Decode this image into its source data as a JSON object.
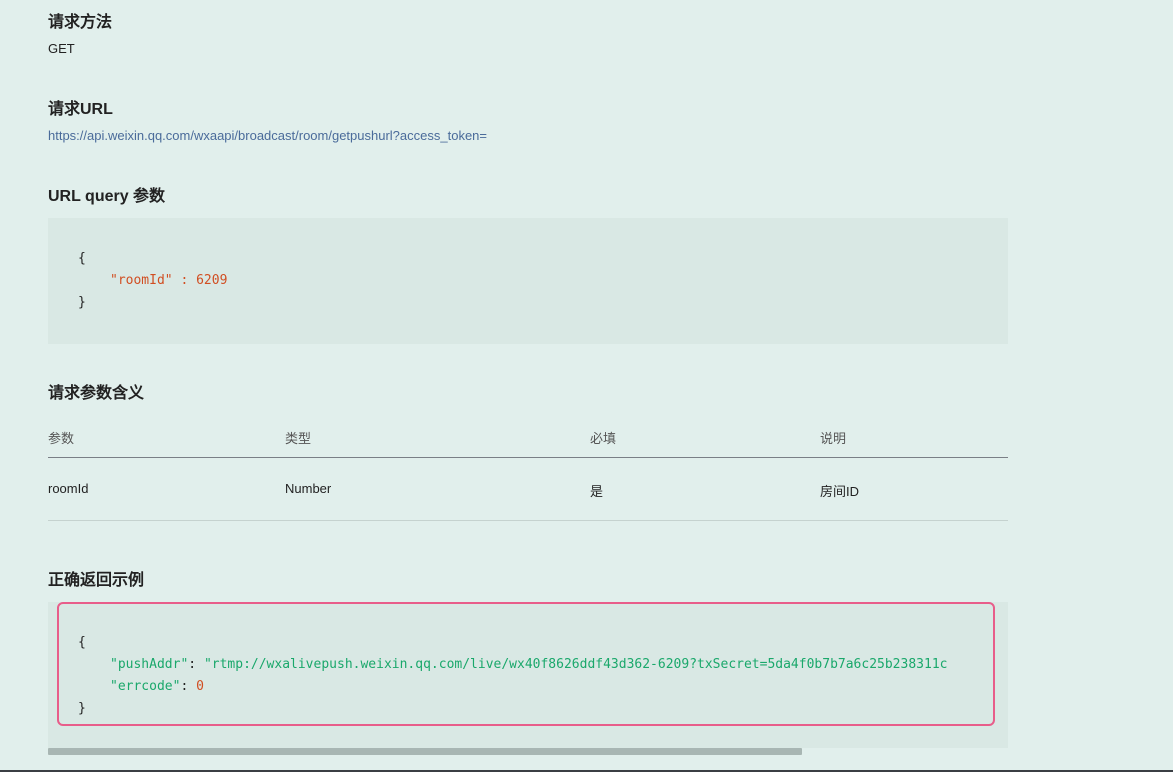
{
  "sections": {
    "method": {
      "title": "请求方法",
      "value": "GET"
    },
    "url": {
      "title": "请求URL",
      "value": "https://api.weixin.qq.com/wxaapi/broadcast/room/getpushurl?access_token="
    },
    "query": {
      "title": "URL query 参数",
      "code": {
        "open": "{",
        "key": "\"roomId\"",
        "sep": " : ",
        "value": "6209",
        "close": "}"
      }
    },
    "params": {
      "title": "请求参数含义",
      "headers": [
        "参数",
        "类型",
        "必填",
        "说明"
      ],
      "rows": [
        [
          "roomId",
          "Number",
          "是",
          "房间ID"
        ]
      ]
    },
    "response": {
      "title": "正确返回示例",
      "code": {
        "open": "{",
        "key1": "\"pushAddr\"",
        "sep1": ": ",
        "value1": "\"rtmp://wxalivepush.weixin.qq.com/live/wx40f8626ddf43d362-6209?txSecret=5da4f0b7b7a6c25b238311c",
        "key2": "\"errcode\"",
        "sep2": ": ",
        "value2": "0",
        "close": "}"
      }
    }
  },
  "colors": {
    "background": "#e1efec",
    "code_background": "#d9e8e4",
    "highlight_border": "#e85d8a",
    "key_orange": "#d14e22",
    "string_green": "#1aa86b",
    "link": "#4a6b9a"
  }
}
